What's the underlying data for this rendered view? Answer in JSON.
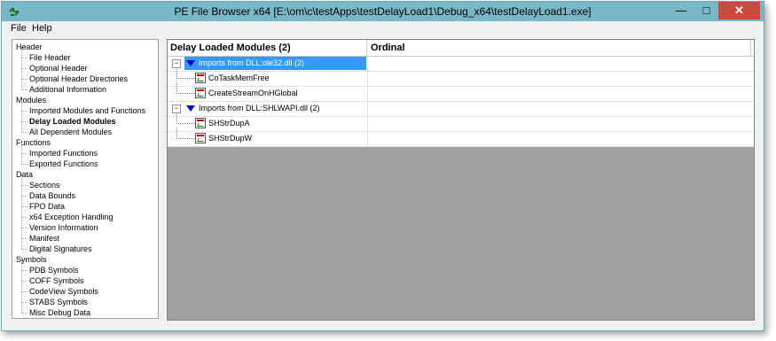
{
  "window": {
    "title": "PE File Browser x64 [E:\\om\\c\\testApps\\testDelayLoad1\\Debug_x64\\testDelayLoad1.exe]",
    "app_icon": "app-icon",
    "controls": {
      "minimize": "—",
      "maximize": "□",
      "close": "✕"
    }
  },
  "menu": {
    "file": "File",
    "help": "Help"
  },
  "tree": [
    {
      "label": "Header",
      "level": 0
    },
    {
      "label": "File Header",
      "level": 1
    },
    {
      "label": "Optional Header",
      "level": 1
    },
    {
      "label": "Optional Header Directories",
      "level": 1
    },
    {
      "label": "Additional Information",
      "level": 1
    },
    {
      "label": "Modules",
      "level": 0
    },
    {
      "label": "Imported Modules and Functions",
      "level": 1
    },
    {
      "label": "Delay Loaded Modules",
      "level": 1,
      "selected": true
    },
    {
      "label": "All Dependent Modules",
      "level": 1
    },
    {
      "label": "Functions",
      "level": 0
    },
    {
      "label": "Imported Functions",
      "level": 1
    },
    {
      "label": "Exported Functions",
      "level": 1
    },
    {
      "label": "Data",
      "level": 0
    },
    {
      "label": "Sections",
      "level": 1
    },
    {
      "label": "Data Bounds",
      "level": 1
    },
    {
      "label": "FPO Data",
      "level": 1
    },
    {
      "label": "x64 Exception Handling",
      "level": 1
    },
    {
      "label": "Version Information",
      "level": 1
    },
    {
      "label": "Manifest",
      "level": 1
    },
    {
      "label": "Digital Signatures",
      "level": 1
    },
    {
      "label": "Symbols",
      "level": 0
    },
    {
      "label": "PDB Symbols",
      "level": 1
    },
    {
      "label": "COFF Symbols",
      "level": 1
    },
    {
      "label": "CodeView Symbols",
      "level": 1
    },
    {
      "label": "STABS Symbols",
      "level": 1
    },
    {
      "label": "Misc Debug Data",
      "level": 1
    }
  ],
  "list": {
    "columns": [
      "Delay Loaded Modules (2)",
      "Ordinal"
    ],
    "rows": [
      {
        "kind": "group",
        "label": "Imports from DLL:ole32.dll (2)",
        "selected": true,
        "expander": "−"
      },
      {
        "kind": "function",
        "label": "CoTaskMemFree"
      },
      {
        "kind": "function",
        "label": "CreateStreamOnHGlobal"
      },
      {
        "kind": "group",
        "label": "Imports from DLL:SHLWAPI.dll (2)",
        "selected": false,
        "expander": "−"
      },
      {
        "kind": "function",
        "label": "SHStrDupA"
      },
      {
        "kind": "function",
        "label": "SHStrDupW"
      }
    ]
  },
  "colors": {
    "titlebar": "#7ab7c6",
    "close_button": "#c74c3c",
    "selection": "#3399ff",
    "empty_area": "#a0a0a0"
  }
}
